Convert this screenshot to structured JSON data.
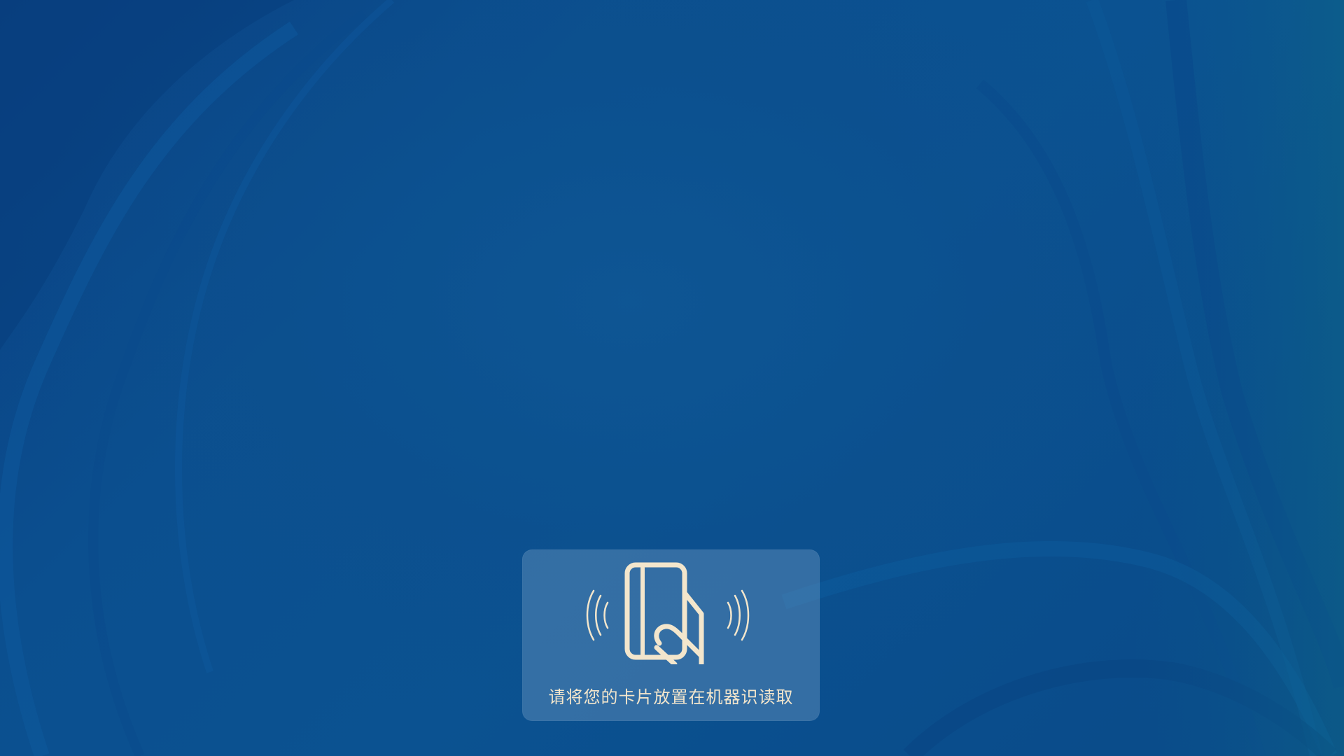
{
  "screen": {
    "background_color": "#0b4f8e",
    "accent_color": "#f3e6cc"
  },
  "card_prompt": {
    "icon": "tap-card-icon",
    "message": "请将您的卡片放置在机器识读取"
  }
}
